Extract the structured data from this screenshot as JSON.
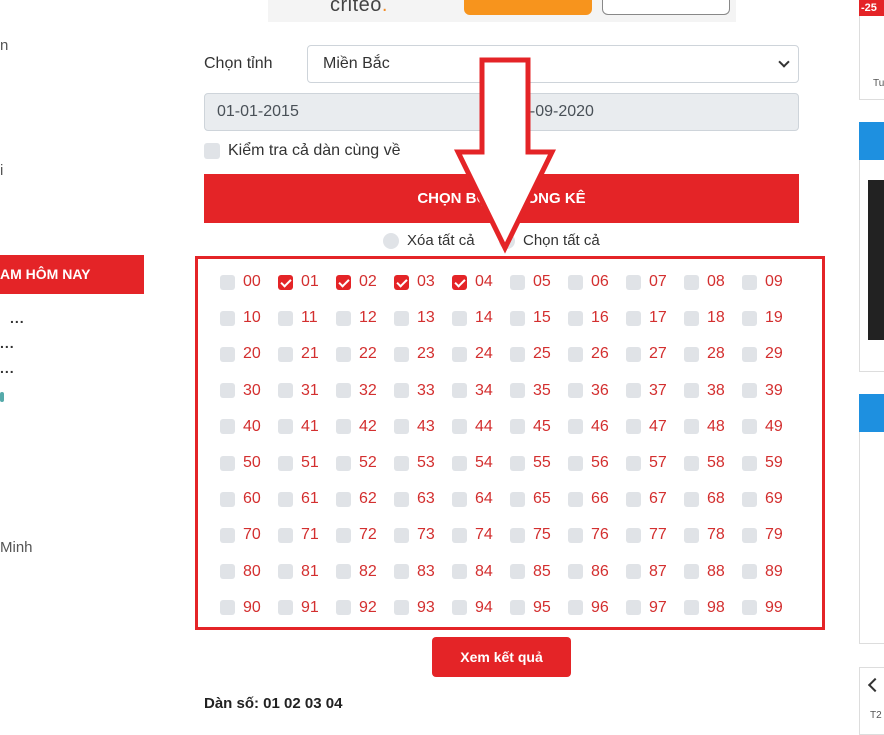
{
  "sidebar": {
    "frag1": "n",
    "frag2": "i",
    "today_label": "AM HÔM NAY",
    "dots": "...",
    "frag3": "Minh"
  },
  "ad": {
    "brand": "criteo",
    "brand_dot": "."
  },
  "form": {
    "province_label": "Chọn tỉnh",
    "province_value": "Miền Bắc",
    "date_from": "01-01-2015",
    "date_to": "0-09-2020",
    "check_all_label": "Kiểm tra cả dàn cùng về",
    "choose_stats_button": "CHỌN BỘ S         THỐNG KÊ",
    "clear_all": "Xóa tất cả",
    "select_all": "Chọn tất cả"
  },
  "numbers": [
    "00",
    "01",
    "02",
    "03",
    "04",
    "05",
    "06",
    "07",
    "08",
    "09",
    "10",
    "11",
    "12",
    "13",
    "14",
    "15",
    "16",
    "17",
    "18",
    "19",
    "20",
    "21",
    "22",
    "23",
    "24",
    "25",
    "26",
    "27",
    "28",
    "29",
    "30",
    "31",
    "32",
    "33",
    "34",
    "35",
    "36",
    "37",
    "38",
    "39",
    "40",
    "41",
    "42",
    "43",
    "44",
    "45",
    "46",
    "47",
    "48",
    "49",
    "50",
    "51",
    "52",
    "53",
    "54",
    "55",
    "56",
    "57",
    "58",
    "59",
    "60",
    "61",
    "62",
    "63",
    "64",
    "65",
    "66",
    "67",
    "68",
    "69",
    "70",
    "71",
    "72",
    "73",
    "74",
    "75",
    "76",
    "77",
    "78",
    "79",
    "80",
    "81",
    "82",
    "83",
    "84",
    "85",
    "86",
    "87",
    "88",
    "89",
    "90",
    "91",
    "92",
    "93",
    "94",
    "95",
    "96",
    "97",
    "98",
    "99"
  ],
  "selected": [
    "01",
    "02",
    "03",
    "04"
  ],
  "result_button": "Xem kết quả",
  "dan_so": "Dàn số: 01 02 03 04",
  "right": {
    "sale": "-25",
    "small1": "Tu",
    "small2": "T2"
  },
  "colors": {
    "accent": "#e42427",
    "number": "#d32f2f",
    "blue": "#1e90e0"
  }
}
